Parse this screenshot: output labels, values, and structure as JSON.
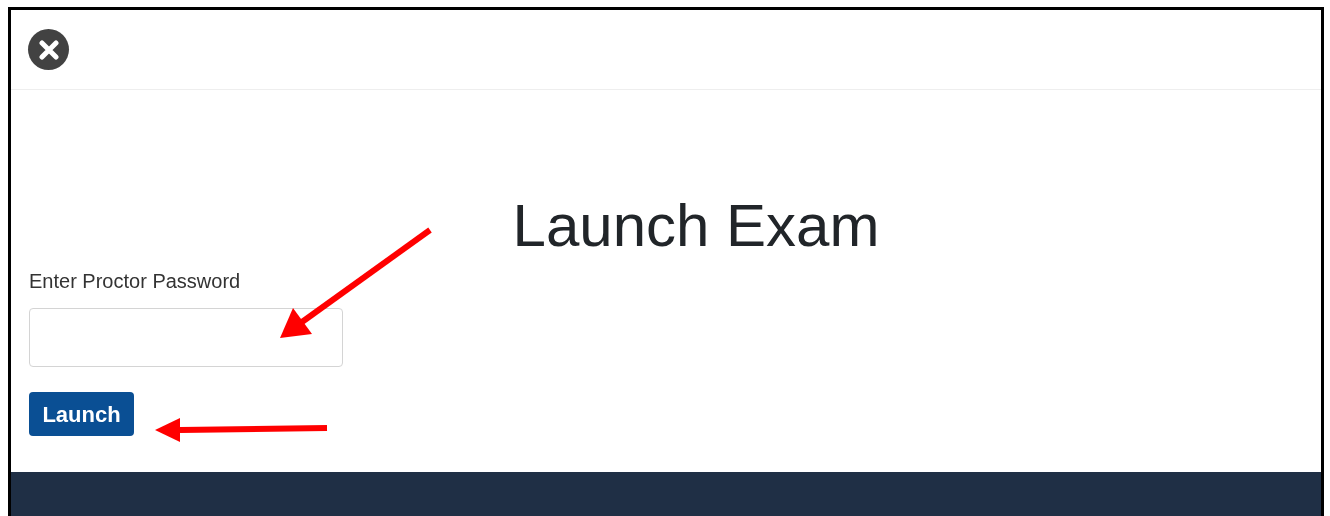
{
  "title": "Launch Exam",
  "password_field": {
    "label": "Enter Proctor Password"
  },
  "launch_button": {
    "label": "Launch"
  }
}
